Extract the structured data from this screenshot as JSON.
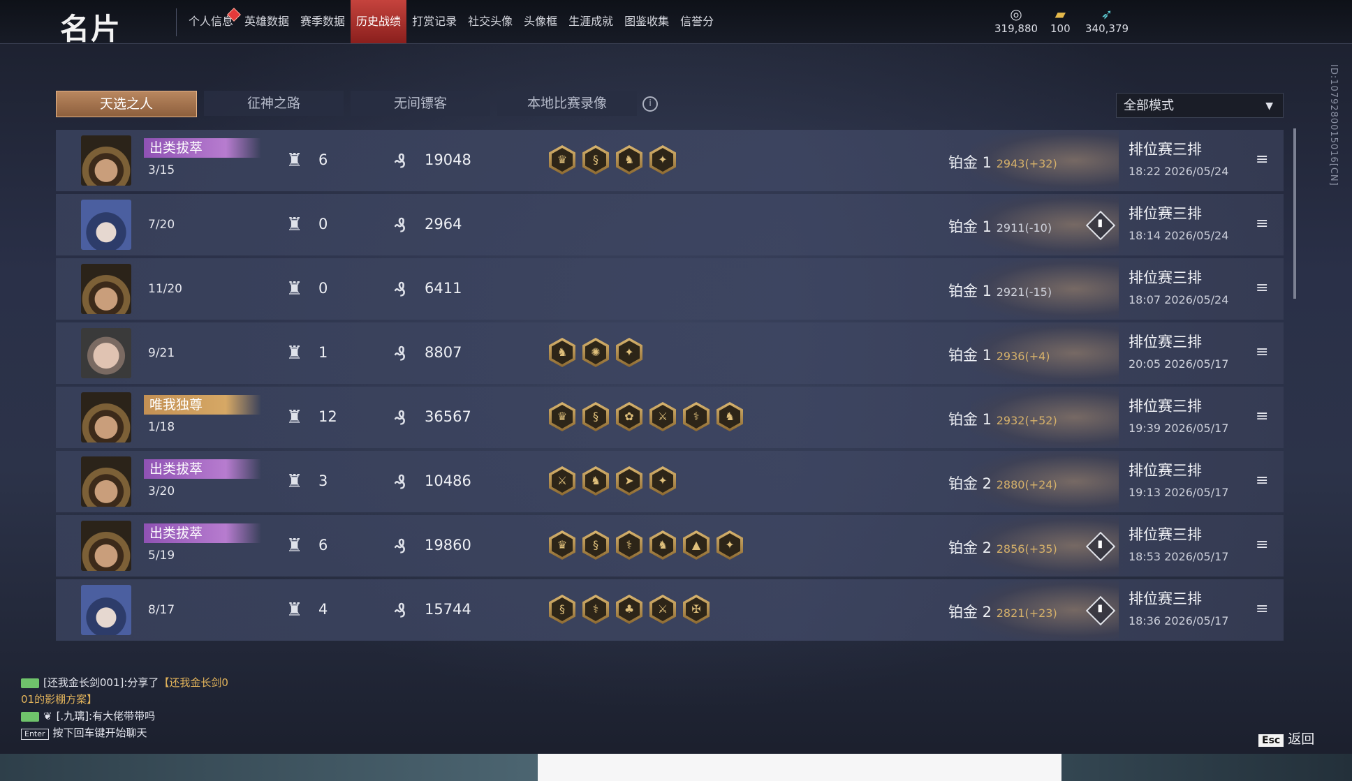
{
  "header": {
    "title": "名片",
    "nav": [
      "个人信息",
      "英雄数据",
      "赛季数据",
      "历史战绩",
      "打赏记录",
      "社交头像",
      "头像框",
      "生涯成就",
      "图鉴收集",
      "信誉分"
    ],
    "active_nav": "历史战绩",
    "currencies": [
      {
        "icon": "coin-pile-icon",
        "value": "319,880"
      },
      {
        "icon": "ticket-icon",
        "value": "100"
      },
      {
        "icon": "feather-icon",
        "value": "340,379"
      }
    ]
  },
  "id_text": "ID:1079280015016[CN]",
  "tabs": [
    "天选之人",
    "征神之路",
    "无间镖客",
    "本地比赛录像"
  ],
  "mode_select": "全部模式",
  "matches": [
    {
      "avatar": "hat",
      "badge": "出类拔萃",
      "badge_color": "purple",
      "kda": "3/15",
      "kills": "6",
      "gold": "19048",
      "medals": [
        "♛",
        "§",
        "♞",
        "✦"
      ],
      "rank": "铂金 1",
      "score": "2943(+32)",
      "pos": true,
      "diamond": false,
      "mode": "排位赛三排",
      "time": "18:22  2026/05/24"
    },
    {
      "avatar": "hood",
      "badge": "",
      "badge_color": "",
      "kda": "7/20",
      "kills": "0",
      "gold": "2964",
      "medals": [],
      "rank": "铂金 1",
      "score": "2911(-10)",
      "pos": false,
      "diamond": true,
      "mode": "排位赛三排",
      "time": "18:14  2026/05/24"
    },
    {
      "avatar": "hat",
      "badge": "",
      "badge_color": "",
      "kda": "11/20",
      "kills": "0",
      "gold": "6411",
      "medals": [],
      "rank": "铂金 1",
      "score": "2921(-15)",
      "pos": false,
      "diamond": false,
      "mode": "排位赛三排",
      "time": "18:07  2026/05/24"
    },
    {
      "avatar": "bald",
      "badge": "",
      "badge_color": "",
      "kda": "9/21",
      "kills": "1",
      "gold": "8807",
      "medals": [
        "♞",
        "✺",
        "✦"
      ],
      "rank": "铂金 1",
      "score": "2936(+4)",
      "pos": true,
      "diamond": false,
      "mode": "排位赛三排",
      "time": "20:05  2026/05/17"
    },
    {
      "avatar": "hat",
      "badge": "唯我独尊",
      "badge_color": "gold",
      "kda": "1/18",
      "kills": "12",
      "gold": "36567",
      "medals": [
        "♛",
        "§",
        "✿",
        "⚔",
        "⚕",
        "♞"
      ],
      "rank": "铂金 1",
      "score": "2932(+52)",
      "pos": true,
      "diamond": false,
      "mode": "排位赛三排",
      "time": "19:39  2026/05/17"
    },
    {
      "avatar": "hat",
      "badge": "出类拔萃",
      "badge_color": "purple",
      "kda": "3/20",
      "kills": "3",
      "gold": "10486",
      "medals": [
        "⚔",
        "♞",
        "➤",
        "✦"
      ],
      "rank": "铂金 2",
      "score": "2880(+24)",
      "pos": true,
      "diamond": false,
      "mode": "排位赛三排",
      "time": "19:13  2026/05/17"
    },
    {
      "avatar": "hat",
      "badge": "出类拔萃",
      "badge_color": "purple",
      "kda": "5/19",
      "kills": "6",
      "gold": "19860",
      "medals": [
        "♛",
        "§",
        "⚕",
        "♞",
        "▲",
        "✦"
      ],
      "rank": "铂金 2",
      "score": "2856(+35)",
      "pos": true,
      "diamond": true,
      "mode": "排位赛三排",
      "time": "18:53  2026/05/17"
    },
    {
      "avatar": "hood",
      "badge": "",
      "badge_color": "",
      "kda": "8/17",
      "kills": "4",
      "gold": "15744",
      "medals": [
        "§",
        "⚕",
        "♣",
        "⚔",
        "✠"
      ],
      "rank": "铂金 2",
      "score": "2821(+23)",
      "pos": true,
      "diamond": true,
      "mode": "排位赛三排",
      "time": "18:36  2026/05/17"
    }
  ],
  "chat": {
    "line1_a": "[还我金长剑001]:分享了",
    "line1_b": "【还我金长剑0",
    "line1_c": "01的影棚方案】",
    "line2": "[.九璃]:有大佬带带吗",
    "hint_key": "Enter",
    "hint": "按下回车键开始聊天"
  },
  "esc": {
    "key": "Esc",
    "label": "返回"
  }
}
